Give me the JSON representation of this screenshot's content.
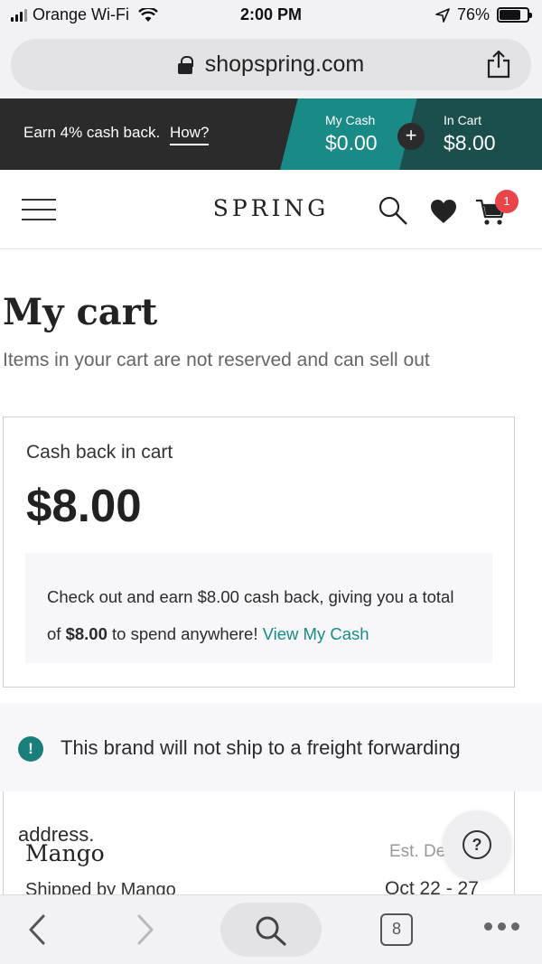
{
  "status_bar": {
    "carrier": "Orange Wi-Fi",
    "time": "2:00 PM",
    "battery": "76%",
    "battery_level": 0.76
  },
  "browser": {
    "url": "shopspring.com",
    "tabs_count": "8"
  },
  "promo": {
    "text": "Earn 4% cash back.",
    "link": "How?",
    "my_cash_label": "My Cash",
    "my_cash_value": "$0.00",
    "plus": "+",
    "in_cart_label": "In Cart",
    "in_cart_value": "$8.00"
  },
  "nav": {
    "logo": "SPRING",
    "cart_count": "1"
  },
  "page": {
    "title": "My cart",
    "subtitle": "Items in your cart are not reserved and can sell out"
  },
  "cashback": {
    "label": "Cash back in cart",
    "amount": "$8.00",
    "info_pre": "Check out and earn $8.00 cash back, giving you a total of ",
    "info_bold": "$8.00",
    "info_post": " to spend anywhere! ",
    "info_link": "View My Cash"
  },
  "notice": {
    "icon": "!",
    "text_line1": "This brand will not ship to a freight forwarding",
    "text_line2": "address."
  },
  "brand": {
    "name": "Mango",
    "shipped_by": "Shipped by Mango",
    "est_label": "Est. De",
    "est_date": "Oct 22 - 27"
  },
  "help": {
    "symbol": "?"
  },
  "colors": {
    "teal": "#1a8a86",
    "dark_teal": "#1b4f4d",
    "banner": "#2b2b2b",
    "badge": "#e8444a"
  }
}
